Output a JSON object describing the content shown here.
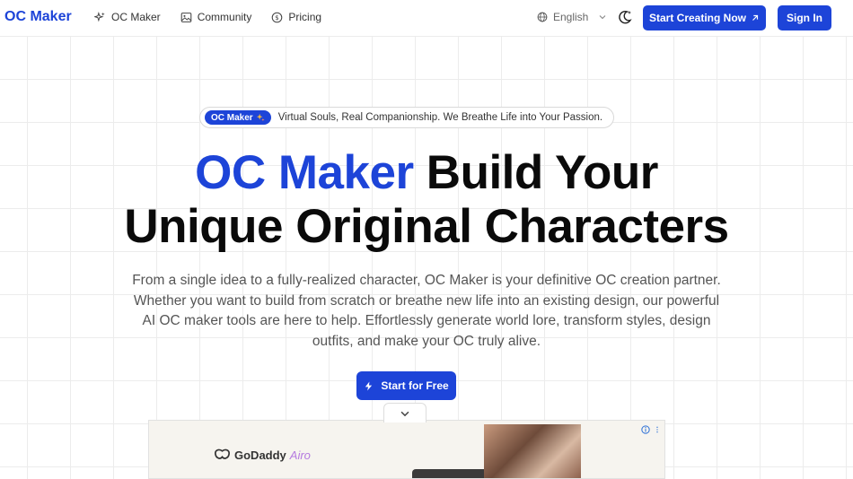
{
  "header": {
    "logo": "OC Maker",
    "nav": [
      {
        "label": "OC Maker",
        "icon": "sparkles-icon"
      },
      {
        "label": "Community",
        "icon": "image-icon"
      },
      {
        "label": "Pricing",
        "icon": "dollar-circle-icon"
      }
    ],
    "language": "English",
    "start_creating": "Start Creating Now",
    "sign_in": "Sign In"
  },
  "hero": {
    "badge": "OC Maker",
    "tagline": "Virtual Souls, Real Companionship. We Breathe Life into Your Passion.",
    "headline_accent": "OC Maker",
    "headline_line1_rest": " Build Your",
    "headline_line2": "Unique Original Characters",
    "description": "From a single idea to a fully-realized character, OC Maker is your definitive OC creation partner. Whether you want to build from scratch or breathe new life into an existing design, our powerful AI OC maker tools are here to help. Effortlessly generate world lore, transform styles, design outfits, and make your OC truly alive.",
    "cta": "Start for Free"
  },
  "ad": {
    "brand": "GoDaddy",
    "brand_suffix": "Airo"
  },
  "colors": {
    "accent": "#1d44d8",
    "text": "#0a0a0a",
    "muted": "#555555"
  }
}
